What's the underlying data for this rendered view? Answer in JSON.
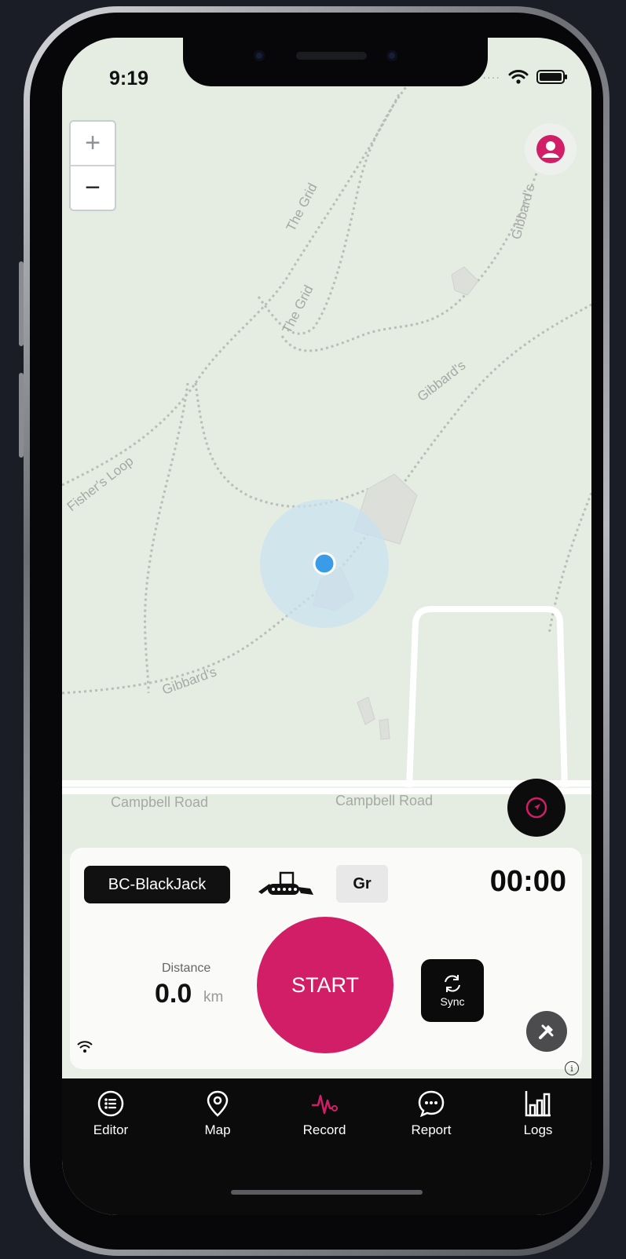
{
  "status_bar": {
    "time": "9:19"
  },
  "map": {
    "zoom_in": "+",
    "zoom_out": "−",
    "trail_labels": [
      "The Grid",
      "The Grid",
      "Gibbard's",
      "Gibbard's",
      "Gibbard's",
      "Fisher's Loop",
      "Campbell Road",
      "Campbell Road"
    ]
  },
  "panel": {
    "vehicle": "BC-BlackJack",
    "grade_label": "Gr",
    "timer": "00:00",
    "distance_label": "Distance",
    "distance_value": "0.0",
    "distance_unit": "km",
    "start_label": "START",
    "sync_label": "Sync"
  },
  "tabs": [
    {
      "label": "Editor",
      "icon": "list-icon",
      "active": false
    },
    {
      "label": "Map",
      "icon": "map-pin-icon",
      "active": false
    },
    {
      "label": "Record",
      "icon": "pulse-icon",
      "active": true
    },
    {
      "label": "Report",
      "icon": "chat-bubble-icon",
      "active": false
    },
    {
      "label": "Logs",
      "icon": "bar-chart-icon",
      "active": false
    }
  ],
  "colors": {
    "accent": "#d21e67",
    "location": "#3a9be6",
    "background": "#1b1d26"
  }
}
